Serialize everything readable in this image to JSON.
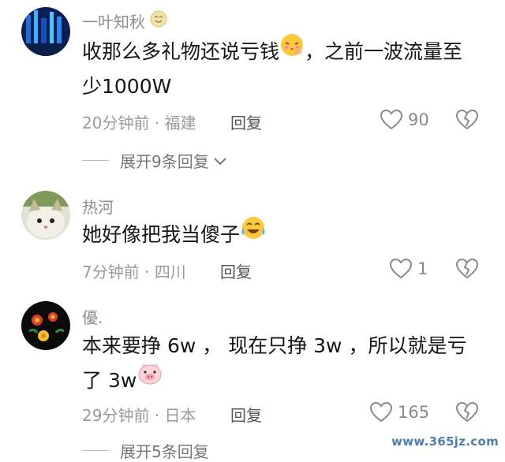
{
  "comments": [
    {
      "username": "一叶知秋",
      "text_line1_a": "收那么多礼物还说亏钱",
      "text_line1_b": "，之前一波流量至",
      "text_line2": "少1000W",
      "time": "20分钟前",
      "location": "福建",
      "reply_label": "回复",
      "likes": "90",
      "expand_label": "展开9条回复"
    },
    {
      "username": "热河",
      "text_line1": "她好像把我当傻子",
      "time": "7分钟前",
      "location": "四川",
      "reply_label": "回复",
      "likes": "1"
    },
    {
      "username": "優.",
      "text_line1": "本来要挣 6w ，  现在只挣 3w  ，所以就是亏",
      "text_line2": "了 3w",
      "time": "29分钟前",
      "location": "日本",
      "reply_label": "回复",
      "likes": "165",
      "expand_label": "展开5条回复"
    }
  ],
  "meta_separator": "·",
  "watermark": "www.365jz.com",
  "colors": {
    "secondary_text": "#9a9a9a",
    "primary_text": "#161616",
    "watermark": "#4a7fb0"
  },
  "icons": [
    "smile-emoji-icon",
    "shy-kiss-emoji-icon",
    "crying-laughing-emoji-icon",
    "pig-face-emoji-icon",
    "heart-icon",
    "broken-heart-icon",
    "chevron-down-icon"
  ]
}
